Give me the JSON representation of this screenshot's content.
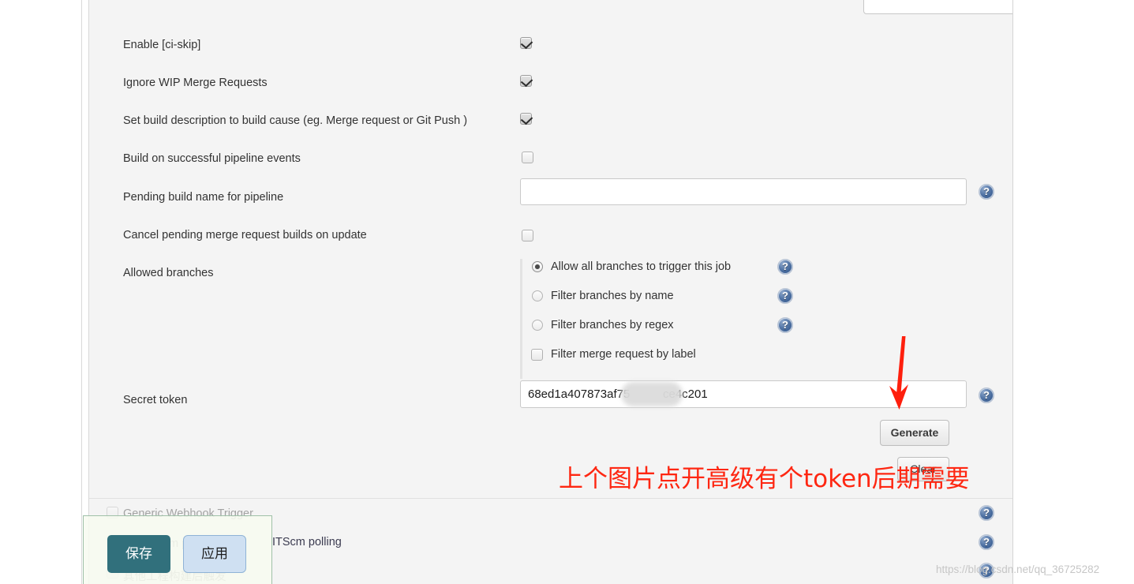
{
  "panel": {
    "rows": [
      {
        "label": "Enable [ci-skip]",
        "control": "checkbox",
        "checked": true
      },
      {
        "label": "Ignore WIP Merge Requests",
        "control": "checkbox",
        "checked": true
      },
      {
        "label": "Set build description to build cause (eg. Merge request or Git Push )",
        "control": "checkbox",
        "checked": true
      },
      {
        "label": "Build on successful pipeline events",
        "control": "checkbox",
        "checked": false
      },
      {
        "label": "Pending build name for pipeline",
        "control": "text",
        "value": "",
        "placeholder": ""
      },
      {
        "label": "Cancel pending merge request builds on update",
        "control": "checkbox",
        "checked": false
      },
      {
        "label": "Allowed branches",
        "control": "radio-group"
      },
      {
        "label": "Secret token",
        "control": "text"
      }
    ],
    "allowed_branches": {
      "options": [
        {
          "label": "Allow all branches to trigger this job",
          "type": "radio",
          "selected": true,
          "help": true
        },
        {
          "label": "Filter branches by name",
          "type": "radio",
          "selected": false,
          "help": true
        },
        {
          "label": "Filter branches by regex",
          "type": "radio",
          "selected": false,
          "help": true
        },
        {
          "label": "Filter merge request by label",
          "type": "checkbox",
          "selected": false,
          "help": false
        }
      ]
    },
    "secret_token": {
      "label": "Secret token",
      "value_prefix": "68ed1a407873af75",
      "value_suffix": "ce4c201",
      "redacted": true,
      "generate_label": "Generate",
      "clear_label": "Clear"
    },
    "bottom_rows": [
      {
        "label": "Generic Webhook Trigger",
        "checked": false
      },
      {
        "label": "or GITScm polling",
        "checked": false
      },
      {
        "label": "其他工程构建后触发",
        "checked": false
      }
    ],
    "bottom_visible_text": "ITScm polling"
  },
  "action_overlay": {
    "save_label": "保存",
    "apply_label": "应用"
  },
  "annotations": {
    "note_text": "上个图片点开高级有个token后期需要",
    "note_color": "#fe2712",
    "arrow_color": "#fe1f0d",
    "arrow_name": "red-down-arrow"
  },
  "watermark": {
    "text": "https://blog.csdn.net/qq_36725282"
  },
  "icons": {
    "help": "help-icon"
  }
}
